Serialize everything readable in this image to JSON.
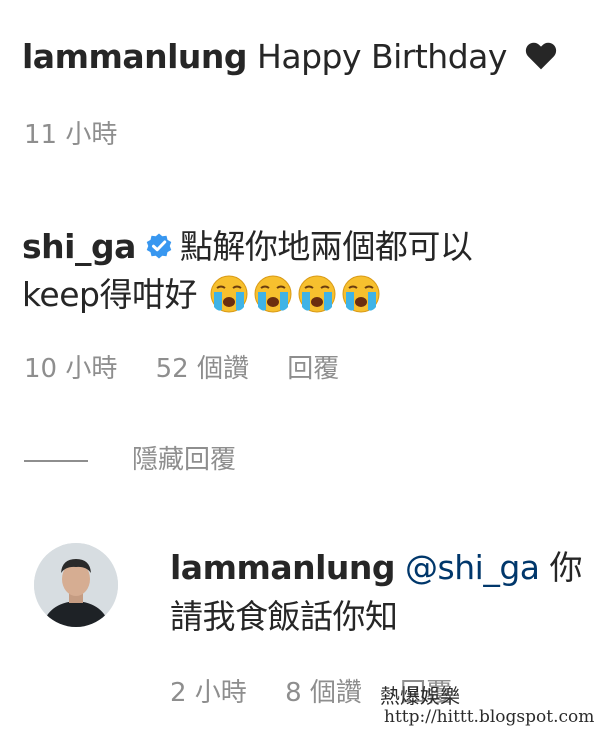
{
  "comment1": {
    "username": "lammanlung",
    "text": "Happy Birthday",
    "heart_icon": "heart-icon",
    "time": "11 小時"
  },
  "comment2": {
    "username": "shi_ga",
    "verified_icon": "verified-badge-icon",
    "text_line1": "點解你地兩個都可以",
    "text_line2": "keep得咁好",
    "emoji_icon": "loudly-crying-face-emoji",
    "emoji_count": 4,
    "time": "10 小時",
    "likes": "52 個讚",
    "reply": "回覆"
  },
  "replies_toggle": {
    "label": "隱藏回覆"
  },
  "reply1": {
    "username": "lammanlung",
    "mention": "@shi_ga",
    "text_line1_rest": "你",
    "text_line2": "請我食飯話你知",
    "time": "2 小時",
    "likes": "8 個讚",
    "reply": "回覆"
  },
  "watermark": {
    "title": "熱爆娛樂",
    "url": "http://hittt.blogspot.com"
  },
  "colors": {
    "text": "#262626",
    "secondary": "#8e8e8e",
    "verified": "#3897f0",
    "mention": "#00376b"
  }
}
